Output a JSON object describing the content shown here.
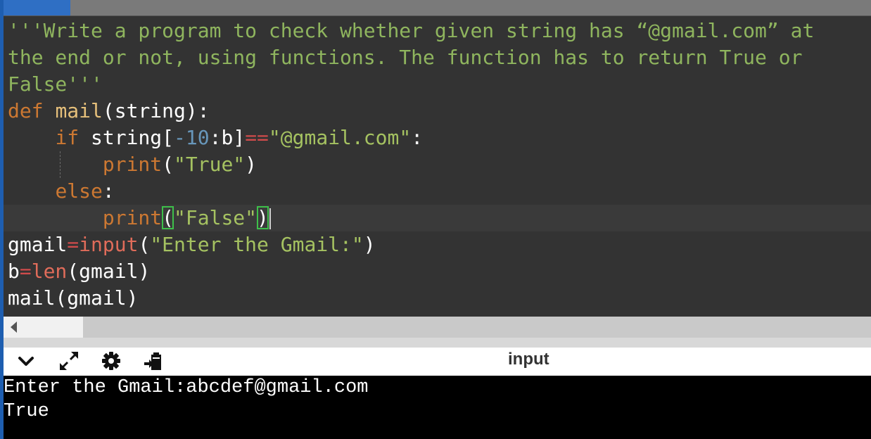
{
  "code": {
    "docstring_lines": [
      "'''Write a program to check whether given string has “@gmail.com” at",
      "the end or not, using functions. The function has to return True or",
      "False'''"
    ],
    "def_kw": "def",
    "func_name": "mail",
    "func_params": "(string):",
    "if_kw": "if",
    "if_var": "string[",
    "if_num": "-10",
    "if_slice": ":b]",
    "if_op": "==",
    "if_str": "\"@gmail.com\"",
    "if_colon": ":",
    "print1_fn": "print",
    "print1_open": "(",
    "print1_str": "\"True\"",
    "print1_close": ")",
    "else_kw": "else",
    "else_colon": ":",
    "print2_fn": "print",
    "print2_open": "(",
    "print2_str": "\"False\"",
    "print2_close": ")",
    "line_gmail_var": "gmail",
    "line_gmail_eq": "=",
    "line_gmail_fn": "input",
    "line_gmail_open": "(",
    "line_gmail_str": "\"Enter the Gmail:\"",
    "line_gmail_close": ")",
    "line_b_var": "b",
    "line_b_eq": "=",
    "line_b_fn": "len",
    "line_b_args": "(gmail)",
    "line_call": "mail(gmail)"
  },
  "toolbar": {
    "title": "input",
    "icons": [
      "chevron-down-icon",
      "expand-icon",
      "gear-icon",
      "clipboard-icon"
    ]
  },
  "console": {
    "lines": [
      "Enter the Gmail:abcdef@gmail.com",
      "True"
    ]
  },
  "colors": {
    "accent": "#2f6fc4",
    "editor_bg": "#333333",
    "console_bg": "#000000"
  }
}
